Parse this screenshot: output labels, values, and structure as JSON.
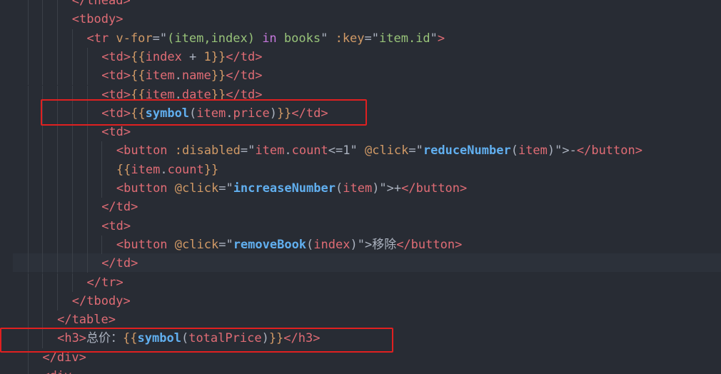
{
  "editor": {
    "theme": "one-dark",
    "colors": {
      "background": "#282c34",
      "tag": "#e06c75",
      "attribute": "#d19a66",
      "string": "#98c379",
      "keyword": "#c678dd",
      "function": "#61afef",
      "annotation_box": "#e02020"
    },
    "lines": [
      {
        "indent": 4,
        "tokens": [
          [
            "tag",
            "</thead>"
          ]
        ]
      },
      {
        "indent": 4,
        "tokens": [
          [
            "tag",
            "<tbody>"
          ]
        ]
      },
      {
        "indent": 5,
        "tokens": [
          [
            "tag",
            "<tr "
          ],
          [
            "attr",
            "v-for"
          ],
          [
            "punc",
            "=\""
          ],
          [
            "str",
            "(item,index) "
          ],
          [
            "kw",
            "in"
          ],
          [
            "str",
            " books"
          ],
          [
            "punc",
            "\" "
          ],
          [
            "attr",
            ":key"
          ],
          [
            "punc",
            "=\""
          ],
          [
            "str",
            "item.id"
          ],
          [
            "punc",
            "\""
          ],
          [
            "tag",
            ">"
          ]
        ]
      },
      {
        "indent": 6,
        "tokens": [
          [
            "tag",
            "<td>"
          ],
          [
            "mustache",
            "{{"
          ],
          [
            "var",
            "index"
          ],
          [
            "punc",
            " + "
          ],
          [
            "num",
            "1"
          ],
          [
            "mustache",
            "}}"
          ],
          [
            "tag",
            "</td>"
          ]
        ]
      },
      {
        "indent": 6,
        "tokens": [
          [
            "tag",
            "<td>"
          ],
          [
            "mustache",
            "{{"
          ],
          [
            "var",
            "item"
          ],
          [
            "punc",
            "."
          ],
          [
            "var",
            "name"
          ],
          [
            "mustache",
            "}}"
          ],
          [
            "tag",
            "</td>"
          ]
        ]
      },
      {
        "indent": 6,
        "tokens": [
          [
            "tag",
            "<td>"
          ],
          [
            "mustache",
            "{{"
          ],
          [
            "var",
            "item"
          ],
          [
            "punc",
            "."
          ],
          [
            "var",
            "date"
          ],
          [
            "mustache",
            "}}"
          ],
          [
            "tag",
            "</td>"
          ]
        ]
      },
      {
        "indent": 6,
        "tokens": [
          [
            "tag",
            "<td>"
          ],
          [
            "mustache",
            "{{"
          ],
          [
            "fn",
            "symbol"
          ],
          [
            "punc",
            "("
          ],
          [
            "var",
            "item"
          ],
          [
            "punc",
            "."
          ],
          [
            "var",
            "price"
          ],
          [
            "punc",
            ")"
          ],
          [
            "mustache",
            "}}"
          ],
          [
            "tag",
            "</td>"
          ]
        ]
      },
      {
        "indent": 6,
        "tokens": [
          [
            "tag",
            "<td>"
          ]
        ]
      },
      {
        "indent": 7,
        "tokens": [
          [
            "tag",
            "<button "
          ],
          [
            "attr",
            ":disabled"
          ],
          [
            "punc",
            "=\""
          ],
          [
            "var",
            "item"
          ],
          [
            "punc",
            "."
          ],
          [
            "var",
            "count"
          ],
          [
            "punc",
            "<=1\" "
          ],
          [
            "attr",
            "@click"
          ],
          [
            "punc",
            "=\""
          ],
          [
            "fn",
            "reduceNumber"
          ],
          [
            "punc",
            "("
          ],
          [
            "var",
            "item"
          ],
          [
            "punc",
            ")\">-"
          ],
          [
            "tag",
            "</button>"
          ]
        ]
      },
      {
        "indent": 7,
        "tokens": [
          [
            "mustache",
            "{{"
          ],
          [
            "var",
            "item"
          ],
          [
            "punc",
            "."
          ],
          [
            "var",
            "count"
          ],
          [
            "mustache",
            "}}"
          ]
        ]
      },
      {
        "indent": 7,
        "tokens": [
          [
            "tag",
            "<button "
          ],
          [
            "attr",
            "@click"
          ],
          [
            "punc",
            "=\""
          ],
          [
            "fn",
            "increaseNumber"
          ],
          [
            "punc",
            "("
          ],
          [
            "var",
            "item"
          ],
          [
            "punc",
            ")\">+"
          ],
          [
            "tag",
            "</button>"
          ]
        ]
      },
      {
        "indent": 6,
        "tokens": [
          [
            "tag",
            "</td>"
          ]
        ]
      },
      {
        "indent": 6,
        "tokens": [
          [
            "tag",
            "<td>"
          ]
        ]
      },
      {
        "indent": 7,
        "tokens": [
          [
            "tag",
            "<button "
          ],
          [
            "attr",
            "@click"
          ],
          [
            "punc",
            "=\""
          ],
          [
            "fn",
            "removeBook"
          ],
          [
            "punc",
            "("
          ],
          [
            "var",
            "index"
          ],
          [
            "punc",
            ")\">"
          ],
          [
            "text",
            "移除"
          ],
          [
            "tag",
            "</button>"
          ]
        ]
      },
      {
        "indent": 6,
        "tokens": [
          [
            "tag",
            "</td>"
          ]
        ]
      },
      {
        "indent": 5,
        "tokens": [
          [
            "tag",
            "</tr>"
          ]
        ]
      },
      {
        "indent": 4,
        "tokens": [
          [
            "tag",
            "</tbody>"
          ]
        ]
      },
      {
        "indent": 3,
        "tokens": [
          [
            "tag",
            "</table>"
          ]
        ]
      },
      {
        "indent": 3,
        "tokens": [
          [
            "tag",
            "<h3>"
          ],
          [
            "text",
            "总价："
          ],
          [
            "mustache",
            "{{"
          ],
          [
            "fn",
            "symbol"
          ],
          [
            "punc",
            "("
          ],
          [
            "var",
            "totalPrice"
          ],
          [
            "punc",
            ")"
          ],
          [
            "mustache",
            "}}"
          ],
          [
            "tag",
            "</h3>"
          ]
        ]
      },
      {
        "indent": 2,
        "tokens": [
          [
            "tag",
            "</div>"
          ]
        ]
      },
      {
        "indent": 2,
        "tokens": [
          [
            "tag",
            "<div"
          ]
        ]
      }
    ]
  }
}
